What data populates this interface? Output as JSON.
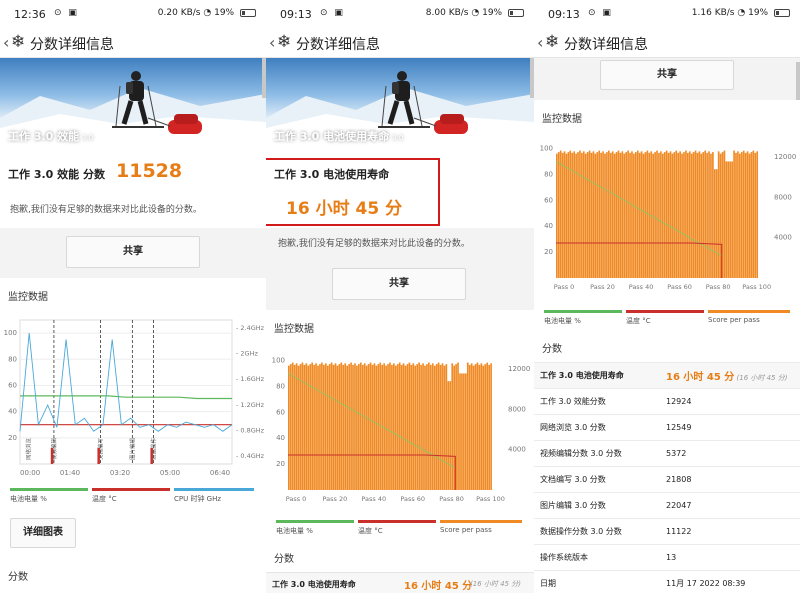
{
  "page_title": "分数详细信息",
  "status_bars": [
    {
      "time": "12:36",
      "network": "0.20 KB/s",
      "battery": "19%"
    },
    {
      "time": "09:13",
      "network": "8.00 KB/s",
      "battery": "19%"
    },
    {
      "time": "09:13",
      "network": "1.16 KB/s",
      "battery": "19%"
    }
  ],
  "panel1": {
    "hero_title": "工作 3.0 效能",
    "hero_version": "3.0",
    "score_label": "工作 3.0 效能 分数",
    "score_value": "11528",
    "notice": "抱歉,我们没有足够的数据来对比此设备的分数。",
    "share": "共享",
    "monitor_title": "监控数据",
    "detail_button": "详细图表",
    "scores_title": "分数"
  },
  "panel2": {
    "hero_title": "工作 3.0 电池使用寿命",
    "hero_version": "3.0",
    "score_label": "工作 3.0 电池使用寿命",
    "score_value": "16 小时 45 分",
    "notice": "抱歉,我们没有足够的数据来对比此设备的分数。",
    "share": "共享",
    "monitor_title": "监控数据",
    "scores_title": "分数",
    "first_row_label": "工作 3.0 电池使用寿命",
    "first_row_value": "16 小时 45 分",
    "first_row_sub": "(16 小时 45 分)"
  },
  "panel3": {
    "share": "共享",
    "monitor_title": "监控数据",
    "scores_title": "分数",
    "rows": [
      {
        "label": "工作 3.0 电池使用寿命",
        "value": "16 小时 45 分",
        "sub": "(16 小时 45 分)",
        "highlight": true
      },
      {
        "label": "工作 3.0 效能分数",
        "value": "12924"
      },
      {
        "label": "网络浏览 3.0 分数",
        "value": "12549"
      },
      {
        "label": "视频编辑分数 3.0 分数",
        "value": "5372"
      },
      {
        "label": "文档编写 3.0 分数",
        "value": "21808"
      },
      {
        "label": "图片编辑 3.0 分数",
        "value": "22047"
      },
      {
        "label": "数据操作分数 3.0 分数",
        "value": "11122"
      },
      {
        "label": "操作系统版本",
        "value": "13"
      },
      {
        "label": "日期",
        "value": "11月 17 2022 08:39"
      }
    ]
  },
  "legend_panel1": [
    {
      "name": "电池电量 %",
      "color": "#5cb85c"
    },
    {
      "name": "温度 °C",
      "color": "#c9302c"
    },
    {
      "name": "CPU 时钟 GHz",
      "color": "#4aa8d8"
    }
  ],
  "legend_battery": [
    {
      "name": "电池电量 %",
      "color": "#5cb85c"
    },
    {
      "name": "温度 °C",
      "color": "#c9302c"
    },
    {
      "name": "Score per pass",
      "color": "#f08a24"
    }
  ],
  "colors": {
    "accent": "#e77d16",
    "highlight_box": "#d11a1a",
    "bar": "#f08a24"
  },
  "chart_data": [
    {
      "type": "line",
      "xlabel": "",
      "ylabel": "",
      "x_ticks": [
        "00:00",
        "01:40",
        "03:20",
        "05:00",
        "06:40"
      ],
      "y_ticks_left": [
        100,
        80,
        60,
        40,
        20
      ],
      "y_ticks_right": [
        "2.4GHz",
        "2GHz",
        "1.6GHz",
        "1.2GHz",
        "0.8GHz",
        "0.4GHz"
      ],
      "ylim": [
        0,
        110
      ],
      "series": [
        {
          "name": "电池电量 %",
          "values": [
            52,
            52,
            52,
            52,
            52,
            52,
            51,
            51,
            51,
            51,
            50,
            50,
            50
          ]
        },
        {
          "name": "温度 °C",
          "values": [
            30,
            30,
            30,
            30,
            30,
            30,
            30,
            30,
            30,
            30,
            30,
            30,
            30
          ]
        },
        {
          "name": "CPU 时钟 GHz",
          "values": [
            25,
            100,
            30,
            45,
            28,
            95,
            30,
            35,
            25,
            30,
            95,
            30,
            35,
            28,
            30,
            25,
            30,
            28,
            32,
            30,
            28,
            30,
            25,
            30
          ]
        }
      ],
      "annotations": [
        "网络浏览",
        "视频编辑",
        "文档编写",
        "图片编辑",
        "数据操作"
      ]
    },
    {
      "type": "bar",
      "x_ticks": [
        "Pass 0",
        "Pass 20",
        "Pass 40",
        "Pass 60",
        "Pass 80",
        "Pass 100"
      ],
      "y_ticks_left": [
        100,
        80,
        60,
        40,
        20
      ],
      "y_ticks_right": [
        12000,
        8000,
        4000
      ],
      "passes": 105,
      "score_per_pass_typical": 11800,
      "battery_start": 90,
      "battery_end": 7,
      "temperature": 27
    },
    {
      "type": "bar",
      "x_ticks": [
        "Pass 0",
        "Pass 20",
        "Pass 40",
        "Pass 60",
        "Pass 80",
        "Pass 100"
      ],
      "y_ticks_left": [
        100,
        80,
        60,
        40,
        20
      ],
      "y_ticks_right": [
        12000,
        8000,
        4000
      ],
      "passes": 105,
      "score_per_pass_typical": 11800,
      "battery_start": 90,
      "battery_end": 7,
      "temperature": 27
    }
  ]
}
